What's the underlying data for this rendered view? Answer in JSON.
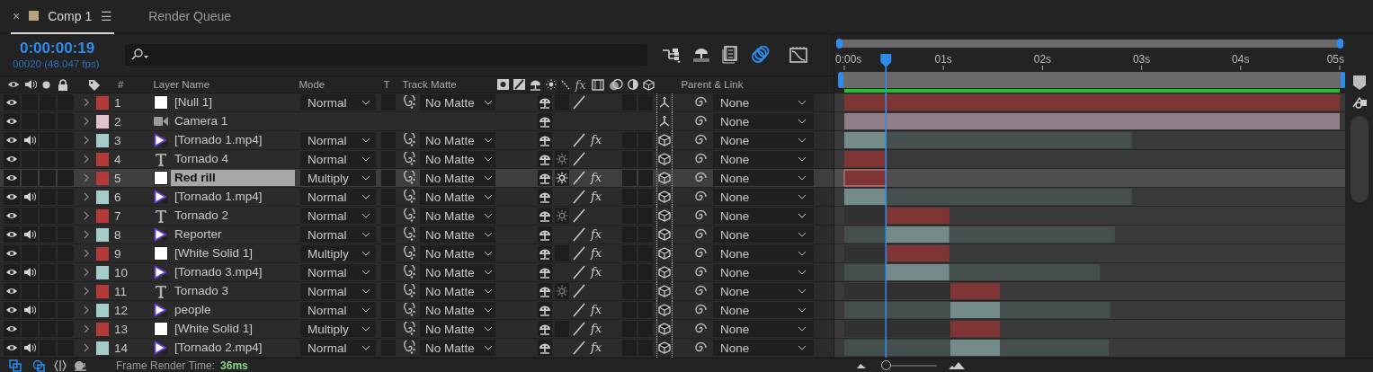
{
  "tabs": [
    {
      "label": "Comp 1",
      "selected": true,
      "color": "#b5a27e",
      "close": "×",
      "menu": "☰"
    },
    {
      "label": "Render Queue",
      "selected": false
    }
  ],
  "current_time": "0:00:00:19",
  "frame_info": "00020 (48.047 fps)",
  "toolbar": [
    {
      "kind": "flowchart",
      "on": false
    },
    {
      "kind": "draft_3d",
      "on": false
    },
    {
      "kind": "frame_blending",
      "on": false
    },
    {
      "kind": "motion_blur",
      "on": true
    },
    {
      "kind": "graph_editor",
      "on": false
    }
  ],
  "columns": {
    "number": "#",
    "layer_name": "Layer Name",
    "mode": "Mode",
    "t": "T",
    "track_matte": "Track Matte",
    "fx": "fx",
    "parent": "Parent & Link"
  },
  "layers": [
    {
      "number": "1",
      "kind": "null",
      "name": "[Null 1]",
      "color": "#b43a3a",
      "visible": true,
      "audio": false,
      "selected": false,
      "mode": "Normal",
      "matte": "No Matte",
      "collapse_box": true,
      "quality": true,
      "parent": "None"
    },
    {
      "number": "2",
      "kind": "camera",
      "name": "Camera 1",
      "color": "#e3c2ce",
      "visible": true,
      "audio": false,
      "selected": false,
      "quality": false,
      "parent": "None"
    },
    {
      "number": "3",
      "kind": "video",
      "name": "[Tornado 1.mp4]",
      "color": "#a5ccc8",
      "visible": true,
      "audio": true,
      "selected": false,
      "mode": "Normal",
      "matte": "No Matte",
      "quality": true,
      "effects": "fx",
      "parent": "None"
    },
    {
      "number": "4",
      "kind": "text",
      "name": "Tornado 4",
      "color": "#b43a3a",
      "visible": true,
      "audio": false,
      "selected": false,
      "mode": "Normal",
      "matte": "No Matte",
      "collapse": false,
      "quality": true,
      "parent": "None"
    },
    {
      "number": "5",
      "kind": "solid",
      "name": "Red rill",
      "color": "#b43a3a",
      "visible": true,
      "audio": false,
      "selected": true,
      "mode": "Multiply",
      "matte": "No Matte",
      "collapse": true,
      "quality": true,
      "effects": "fx",
      "parent": "None"
    },
    {
      "number": "6",
      "kind": "video",
      "name": "[Tornado 1.mp4]",
      "color": "#a5ccc8",
      "visible": true,
      "audio": true,
      "selected": false,
      "mode": "Normal",
      "matte": "No Matte",
      "quality": true,
      "effects": "fx",
      "parent": "None"
    },
    {
      "number": "7",
      "kind": "text",
      "name": "Tornado 2",
      "color": "#b43a3a",
      "visible": true,
      "audio": false,
      "selected": false,
      "mode": "Normal",
      "matte": "No Matte",
      "collapse": false,
      "quality": true,
      "parent": "None"
    },
    {
      "number": "8",
      "kind": "video",
      "name": "Reporter",
      "color": "#a5ccc8",
      "visible": true,
      "audio": true,
      "selected": false,
      "mode": "Normal",
      "matte": "No Matte",
      "quality": true,
      "effects": "fx",
      "parent": "None"
    },
    {
      "number": "9",
      "kind": "solid",
      "name": "[White Solid 1]",
      "color": "#b43a3a",
      "visible": true,
      "audio": false,
      "selected": false,
      "mode": "Multiply",
      "matte": "No Matte",
      "collapse_box": true,
      "quality": true,
      "effects": "fx",
      "parent": "None"
    },
    {
      "number": "10",
      "kind": "video",
      "name": "[Tornado 3.mp4]",
      "color": "#a5ccc8",
      "visible": true,
      "audio": true,
      "selected": false,
      "mode": "Normal",
      "matte": "No Matte",
      "quality": true,
      "effects": "fx",
      "parent": "None"
    },
    {
      "number": "11",
      "kind": "text",
      "name": "Tornado 3",
      "color": "#b43a3a",
      "visible": true,
      "audio": false,
      "selected": false,
      "mode": "Normal",
      "matte": "No Matte",
      "collapse": false,
      "quality": true,
      "parent": "None"
    },
    {
      "number": "12",
      "kind": "video",
      "name": "people",
      "color": "#a5ccc8",
      "visible": true,
      "audio": true,
      "selected": false,
      "mode": "Normal",
      "matte": "No Matte",
      "quality": true,
      "effects": "fx",
      "parent": "None"
    },
    {
      "number": "13",
      "kind": "solid",
      "name": "[White Solid 1]",
      "color": "#b43a3a",
      "visible": true,
      "audio": false,
      "selected": false,
      "mode": "Multiply",
      "matte": "No Matte",
      "collapse_box": true,
      "quality": true,
      "effects": "fx",
      "parent": "None"
    },
    {
      "number": "14",
      "kind": "video",
      "name": "[Tornado 2.mp4]",
      "color": "#a5ccc8",
      "visible": true,
      "audio": true,
      "selected": false,
      "mode": "Normal",
      "matte": "No Matte",
      "quality": true,
      "effects": "fx",
      "parent": "None"
    }
  ],
  "timeline": {
    "chart_data": {
      "type": "bar",
      "orientation": "horizontal",
      "stacked": true,
      "xlim": [
        0,
        5
      ],
      "xticks": [
        {
          "value": 0,
          "label": "0:00s"
        },
        {
          "value": 1,
          "label": "01s"
        },
        {
          "value": 2,
          "label": "02s"
        },
        {
          "value": 3,
          "label": "03s"
        },
        {
          "value": 4,
          "label": "04s"
        },
        {
          "value": 5,
          "label": "05s"
        }
      ],
      "series": [
        {
          "color": "#313131",
          "values": [
            0,
            0,
            0,
            0,
            0,
            0,
            0.42,
            0,
            0.42,
            0,
            1.07,
            0,
            1.07,
            0
          ]
        },
        {
          "color": "#454f4e",
          "values": [
            0,
            0,
            0,
            0,
            0,
            0,
            0,
            0.42,
            0,
            0.42,
            0,
            1.07,
            0,
            1.07
          ]
        },
        {
          "color": "#803535",
          "values": [
            5,
            0,
            0,
            0.42,
            0.42,
            0,
            0.64,
            0,
            0.64,
            0,
            0.5,
            0,
            0.5,
            0
          ]
        },
        {
          "color": "#917f87",
          "values": [
            0,
            5,
            0,
            0,
            0,
            0,
            0,
            0,
            0,
            0,
            0,
            0,
            0,
            0
          ]
        },
        {
          "color": "#748c89",
          "values": [
            0,
            0,
            0.42,
            0,
            0,
            0.42,
            0,
            0.64,
            0,
            0.64,
            0,
            0.5,
            0,
            0.5
          ]
        },
        {
          "color": "#454f4e",
          "values": [
            0,
            0,
            2.48,
            0,
            0,
            2.48,
            0,
            1.67,
            0,
            1.52,
            0,
            1.11,
            0,
            1.1
          ]
        }
      ],
      "ref_lines": [
        {
          "axis": "x",
          "value": 0.42
        }
      ]
    }
  },
  "status_bar": {
    "label": "Frame Render Time:",
    "value": "36ms",
    "zoom": {
      "level": 0.05
    }
  }
}
